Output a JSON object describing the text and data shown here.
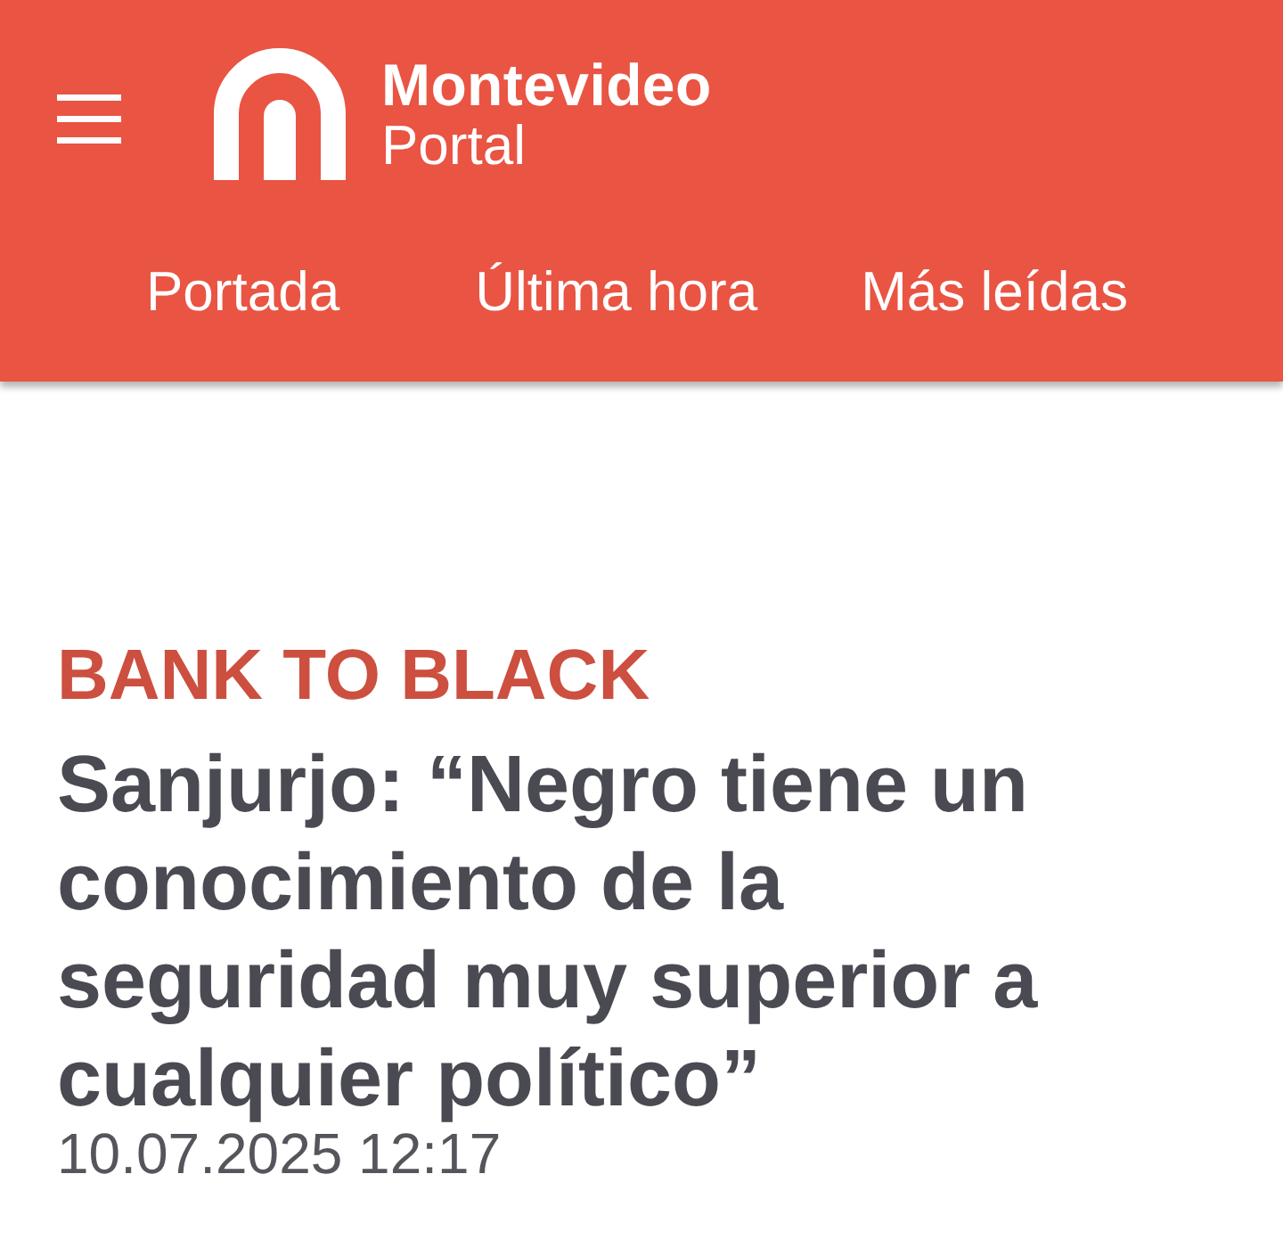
{
  "header": {
    "logo": {
      "name": "Montevideo",
      "subtitle": "Portal"
    },
    "nav": [
      {
        "label": "Portada"
      },
      {
        "label": "Última hora"
      },
      {
        "label": "Más leídas"
      }
    ]
  },
  "article": {
    "section": "BANK TO BLACK",
    "headline": "Sanjurjo: “Negro tiene un conocimiento de la seguridad muy superior a cualquier político”",
    "date": "10.07.2025 12:17"
  }
}
